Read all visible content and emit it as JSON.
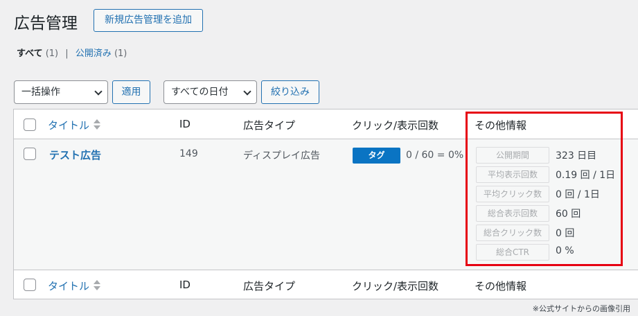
{
  "header": {
    "title": "広告管理",
    "add_button": "新規広告管理を追加"
  },
  "filters": {
    "all_label": "すべて",
    "all_count": "(1)",
    "separator": "|",
    "published_label": "公開済み",
    "published_count": "(1)"
  },
  "actions": {
    "bulk_select": "一括操作",
    "apply_button": "適用",
    "date_select": "すべての日付",
    "filter_button": "絞り込み"
  },
  "columns": {
    "title": "タイトル",
    "id": "ID",
    "ad_type": "広告タイプ",
    "clicks": "クリック/表示回数",
    "other": "その他情報"
  },
  "row": {
    "title": "テスト広告",
    "id": "149",
    "ad_type": "ディスプレイ広告",
    "tag_label": "タグ",
    "clicks": "0 / 60 = 0%",
    "info": [
      {
        "label": "公開期間",
        "value": "323 日目"
      },
      {
        "label": "平均表示回数",
        "value": "0.19 回 / 1日"
      },
      {
        "label": "平均クリック数",
        "value": "0 回 / 1日"
      },
      {
        "label": "総合表示回数",
        "value": "60 回"
      },
      {
        "label": "総合クリック数",
        "value": "0 回"
      },
      {
        "label": "総合CTR",
        "value": "0 %"
      }
    ]
  },
  "footnote": "※公式サイトからの画像引用",
  "colors": {
    "accent": "#2271b1",
    "tag": "#0a74c3",
    "highlight": "#e60012"
  }
}
